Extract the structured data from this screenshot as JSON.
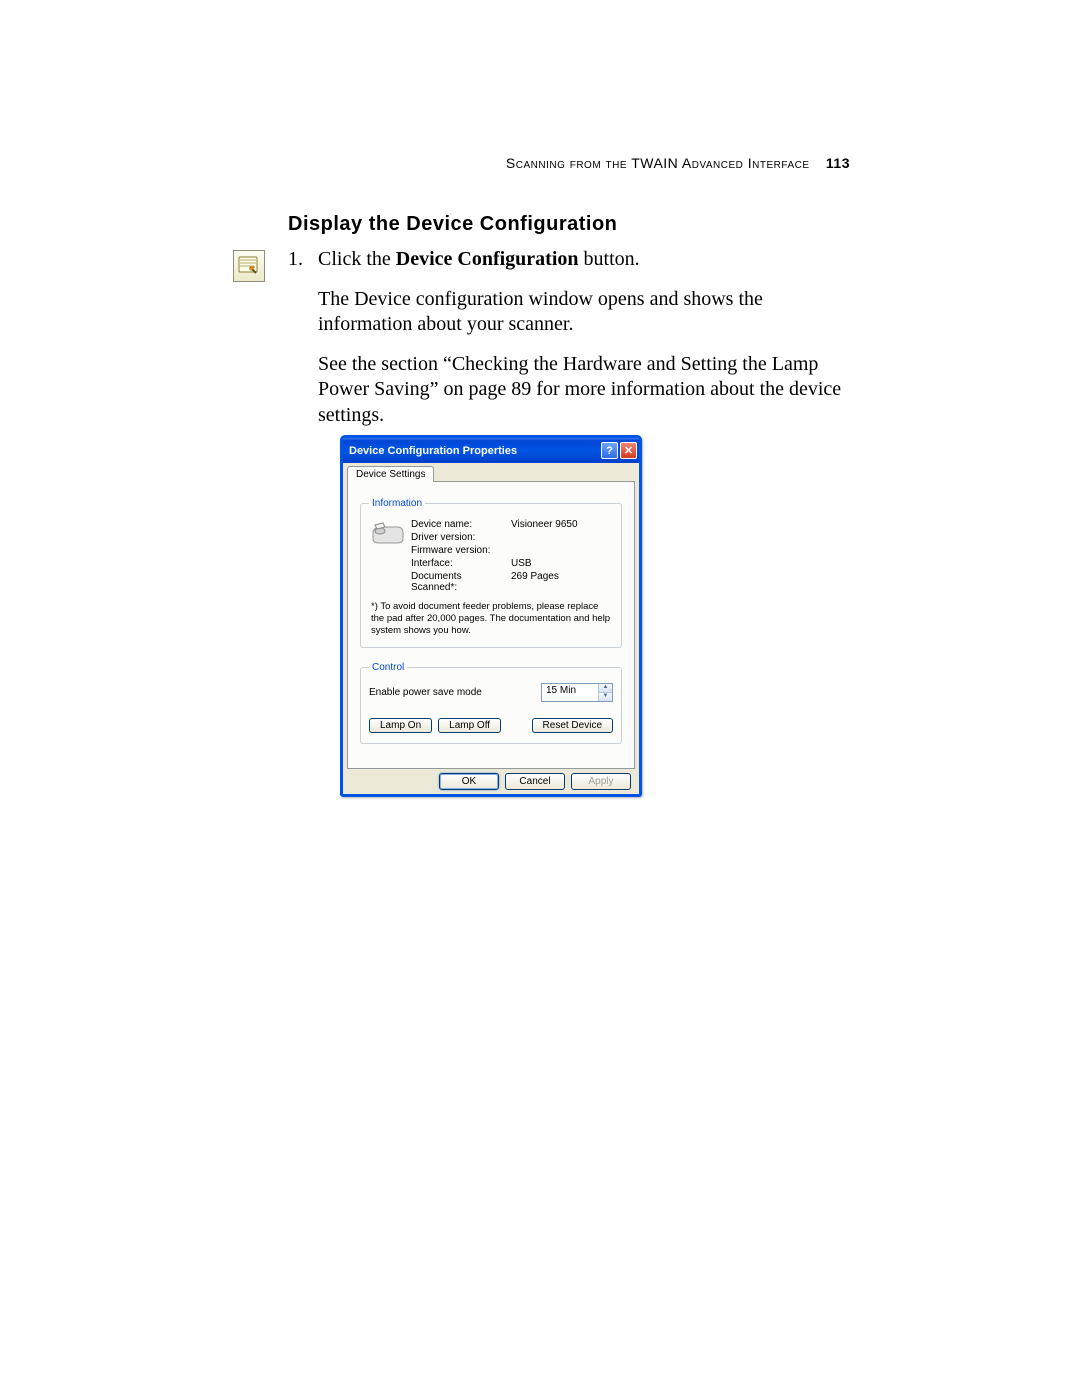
{
  "header": {
    "running_head": "Scanning from the TWAIN Advanced Interface",
    "page_number": "113"
  },
  "section_title": "Display the Device Configuration",
  "step": {
    "number": "1.",
    "text_prefix": "Click the ",
    "bold_text": "Device Configuration",
    "text_suffix": " button."
  },
  "paragraphs": {
    "p1": "The Device configuration window opens and shows the information about your scanner.",
    "p2": "See the section “Checking the Hardware and Setting the Lamp Power Saving” on page 89 for more information about the device settings."
  },
  "dialog": {
    "title": "Device Configuration Properties",
    "help_symbol": "?",
    "close_symbol": "✕",
    "tab_label": "Device Settings",
    "info": {
      "legend": "Information",
      "rows": {
        "device_name_label": "Device name:",
        "device_name_value": "Visioneer 9650",
        "driver_version_label": "Driver version:",
        "driver_version_value": "",
        "firmware_version_label": "Firmware version:",
        "firmware_version_value": "",
        "interface_label": "Interface:",
        "interface_value": "USB",
        "docs_scanned_label": "Documents Scanned*:",
        "docs_scanned_value": "269 Pages"
      },
      "footnote": "*)  To avoid document feeder problems, please replace the pad after 20,000 pages. The documentation and help system shows you how."
    },
    "control": {
      "legend": "Control",
      "power_save_label": "Enable power save mode",
      "power_save_value": "15 Min",
      "lamp_on": "Lamp On",
      "lamp_off": "Lamp Off",
      "reset_device": "Reset Device"
    },
    "buttons": {
      "ok": "OK",
      "cancel": "Cancel",
      "apply": "Apply"
    }
  }
}
